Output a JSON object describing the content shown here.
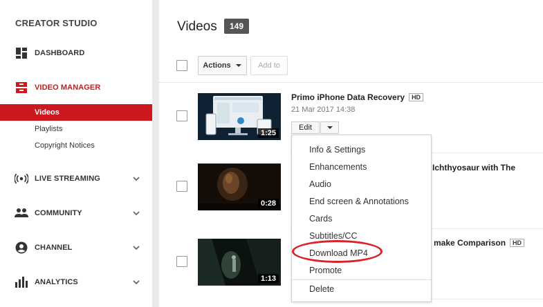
{
  "sidebar": {
    "title": "CREATOR STUDIO",
    "items": [
      {
        "label": "DASHBOARD",
        "icon": "dashboard-icon"
      },
      {
        "label": "VIDEO MANAGER",
        "icon": "video-manager-icon"
      },
      {
        "label": "LIVE STREAMING",
        "icon": "live-streaming-icon"
      },
      {
        "label": "COMMUNITY",
        "icon": "community-icon"
      },
      {
        "label": "CHANNEL",
        "icon": "channel-icon"
      },
      {
        "label": "ANALYTICS",
        "icon": "analytics-icon"
      }
    ],
    "subitems": [
      {
        "label": "Videos"
      },
      {
        "label": "Playlists"
      },
      {
        "label": "Copyright Notices"
      }
    ],
    "accent_color": "#cc181e"
  },
  "main": {
    "title": "Videos",
    "count": "149",
    "actions_label": "Actions",
    "add_to_label": "Add to",
    "videos": [
      {
        "title": "Primo iPhone Data Recovery",
        "hd": "HD",
        "date": "21 Mar 2017 14:38",
        "duration": "1:25"
      },
      {
        "title_partial": "Ichthyosaur with The",
        "duration": "0:28"
      },
      {
        "title_partial": "make Comparison",
        "hd": "HD",
        "duration": "1:13"
      }
    ],
    "edit_label": "Edit"
  },
  "menu": {
    "items": [
      {
        "label": "Info & Settings"
      },
      {
        "label": "Enhancements"
      },
      {
        "label": "Audio"
      },
      {
        "label": "End screen & Annotations"
      },
      {
        "label": "Cards"
      },
      {
        "label": "Subtitles/CC"
      },
      {
        "label": "Download MP4"
      },
      {
        "label": "Promote"
      },
      {
        "label": "Delete"
      }
    ],
    "highlight_color": "#d9222a"
  }
}
